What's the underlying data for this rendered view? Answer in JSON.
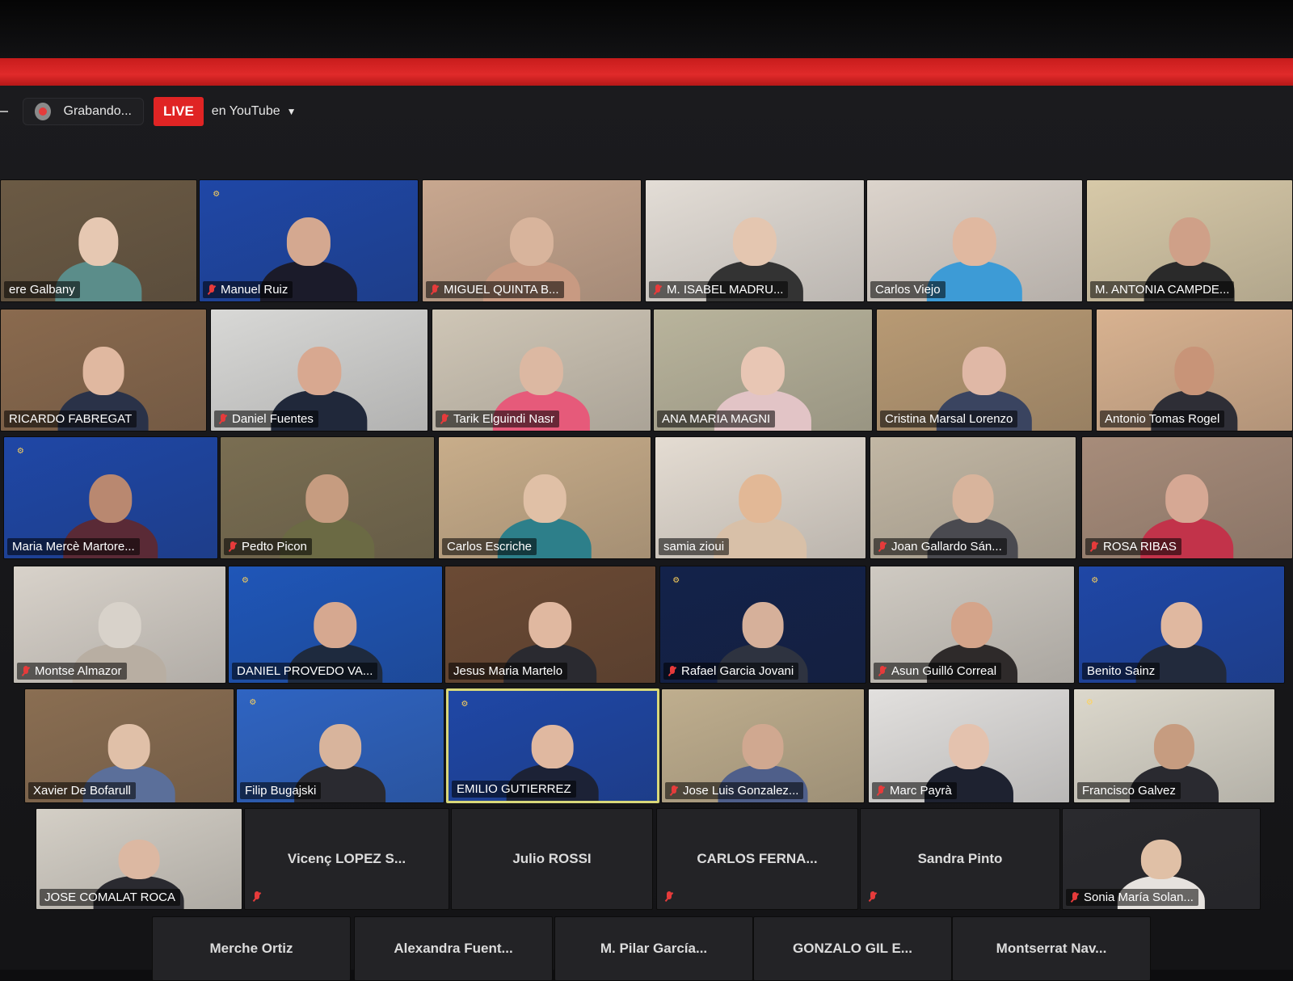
{
  "toolbar": {
    "recording_label": "Grabando...",
    "live_label": "LIVE",
    "stream_target": "en YouTube"
  },
  "colors": {
    "live": "#e02424",
    "muted_mic": "#e63b3b",
    "active_speaker": "#d9d87a"
  },
  "tiles": [
    {
      "name": "ere Galbany",
      "muted": false,
      "bg": "#6b5a44",
      "skin": "#e6c8b2",
      "shirt": "#5b8d8a"
    },
    {
      "name": "Manuel Ruiz",
      "muted": true,
      "bg": "#1f47a6",
      "skin": "#d4a890",
      "shirt": "#1b1b2a",
      "rotary": true
    },
    {
      "name": "MIGUEL QUINTA B...",
      "muted": true,
      "bg": "#c8a78f",
      "skin": "#d8b49c",
      "shirt": "#c89a82"
    },
    {
      "name": "M. ISABEL MADRU...",
      "muted": true,
      "bg": "#e3ddd6",
      "skin": "#e4c6b0",
      "shirt": "#333"
    },
    {
      "name": "Carlos Viejo",
      "muted": false,
      "bg": "#dcd4cc",
      "skin": "#e0b8a0",
      "shirt": "#3d9bd6"
    },
    {
      "name": "M. ANTONIA CAMPDE...",
      "muted": false,
      "bg": "#d7c9a8",
      "skin": "#cfa088",
      "shirt": "#2a2a2a"
    },
    {
      "name": "RICARDO FABREGAT",
      "muted": false,
      "bg": "#8a6a4e",
      "skin": "#e0b8a0",
      "shirt": "#2a3248"
    },
    {
      "name": "Daniel Fuentes",
      "muted": true,
      "bg": "#d8d8d6",
      "skin": "#d8a890",
      "shirt": "#20283a"
    },
    {
      "name": "Tarik Elguindi Nasr",
      "muted": true,
      "bg": "#cfc6b6",
      "skin": "#dcb8a2",
      "shirt": "#e65a7a"
    },
    {
      "name": "ANA MARIA MAGNI",
      "muted": false,
      "bg": "#b9b49c",
      "skin": "#e8c6b4",
      "shirt": "#e2c4c6"
    },
    {
      "name": "Cristina Marsal Lorenzo",
      "muted": false,
      "bg": "#b89a74",
      "skin": "#e0b8a6",
      "shirt": "#3a4460"
    },
    {
      "name": "Antonio Tomas  Rogel",
      "muted": false,
      "bg": "#d8b290",
      "skin": "#c89478",
      "shirt": "#2e2e36"
    },
    {
      "name": "Maria Mercè Martore...",
      "muted": false,
      "bg": "#1f47a6",
      "skin": "#b98870",
      "shirt": "#5a2a36",
      "rotary": true
    },
    {
      "name": "Pedto Picon",
      "muted": true,
      "bg": "#7a6e52",
      "skin": "#c69c80",
      "shirt": "#6b6a44"
    },
    {
      "name": "Carlos Escriche",
      "muted": false,
      "bg": "#c8ad8a",
      "skin": "#e0c0a6",
      "shirt": "#2d7f8a"
    },
    {
      "name": "samia zioui",
      "muted": false,
      "bg": "#e4dcd2",
      "skin": "#e2b896",
      "shirt": "#d8c0a8"
    },
    {
      "name": "Joan Gallardo Sán...",
      "muted": true,
      "bg": "#c2b7a4",
      "skin": "#d8b49c",
      "shirt": "#4a4a50"
    },
    {
      "name": "ROSA RIBAS",
      "muted": true,
      "bg": "#a78c7a",
      "skin": "#d6a894",
      "shirt": "#c2334a"
    },
    {
      "name": "Montse Almazor",
      "muted": true,
      "bg": "#d8d2ca",
      "skin": "#d8d2ca",
      "shirt": "#b8aea2"
    },
    {
      "name": "DANIEL PROVEDO VA...",
      "muted": false,
      "bg": "#1f56b8",
      "skin": "#d6a890",
      "shirt": "#1e2a3e",
      "rotary": true
    },
    {
      "name": "Jesus Maria Martelo",
      "muted": false,
      "bg": "#6b4a34",
      "skin": "#e0b8a0",
      "shirt": "#2a2a30"
    },
    {
      "name": "Rafael Garcia Jovani",
      "muted": true,
      "bg": "#13224a",
      "skin": "#d6b09a",
      "shirt": "#2e3340",
      "rotary": true
    },
    {
      "name": "Asun Guilló Correal",
      "muted": true,
      "bg": "#cfcac2",
      "skin": "#d4a48a",
      "shirt": "#2e2a2a"
    },
    {
      "name": "Benito Sainz",
      "muted": false,
      "bg": "#1f47a6",
      "skin": "#e0b8a0",
      "shirt": "#222a3c",
      "rotary": true
    },
    {
      "name": "Xavier De Bofarull",
      "muted": false,
      "bg": "#8a6e52",
      "skin": "#e0c0a8",
      "shirt": "#5b6f9a"
    },
    {
      "name": "Filip Bugajski",
      "muted": false,
      "bg": "#2f64c2",
      "skin": "#d8b49c",
      "shirt": "#2a2a30",
      "rotary": true
    },
    {
      "name": "EMILIO GUTIERREZ",
      "muted": false,
      "bg": "#1f47a6",
      "skin": "#e0b8a0",
      "shirt": "#1c2236",
      "active": true,
      "rotary": true
    },
    {
      "name": "Jose Luis Gonzalez...",
      "muted": true,
      "bg": "#bfae8e",
      "skin": "#d0a890",
      "shirt": "#4f5f8a"
    },
    {
      "name": "Marc Payrà",
      "muted": true,
      "bg": "#e2e0de",
      "skin": "#e4c2ae",
      "shirt": "#1e2230"
    },
    {
      "name": "Francisco Galvez",
      "muted": false,
      "bg": "#dcd8cc",
      "skin": "#c69c80",
      "shirt": "#2a2a30",
      "rotary": true
    },
    {
      "name": "JOSE COMALAT ROCA",
      "muted": false,
      "bg": "#d4cfc6",
      "skin": "#dcb8a2",
      "shirt": "#2a2a30"
    },
    {
      "name": "Vicenç LOPEZ S...",
      "blank": true,
      "muted": true
    },
    {
      "name": "Julio ROSSI",
      "blank": true,
      "muted": false
    },
    {
      "name": "CARLOS FERNA...",
      "blank": true,
      "muted": true
    },
    {
      "name": "Sandra Pinto",
      "blank": true,
      "muted": true
    },
    {
      "name": "Sonia María Solan...",
      "muted": true,
      "bg": "#2a2a2e",
      "skin": "#e0c0a6",
      "shirt": "#e6e2de"
    },
    {
      "name": "Merche Ortiz",
      "blank": true,
      "muted": false
    },
    {
      "name": "Alexandra  Fuent...",
      "blank": true,
      "muted": false
    },
    {
      "name": "M. Pilar García...",
      "blank": true,
      "muted": false
    },
    {
      "name": "GONZALO GIL E...",
      "blank": true,
      "muted": false
    },
    {
      "name": "Montserrat  Nav...",
      "blank": true,
      "muted": false
    }
  ]
}
